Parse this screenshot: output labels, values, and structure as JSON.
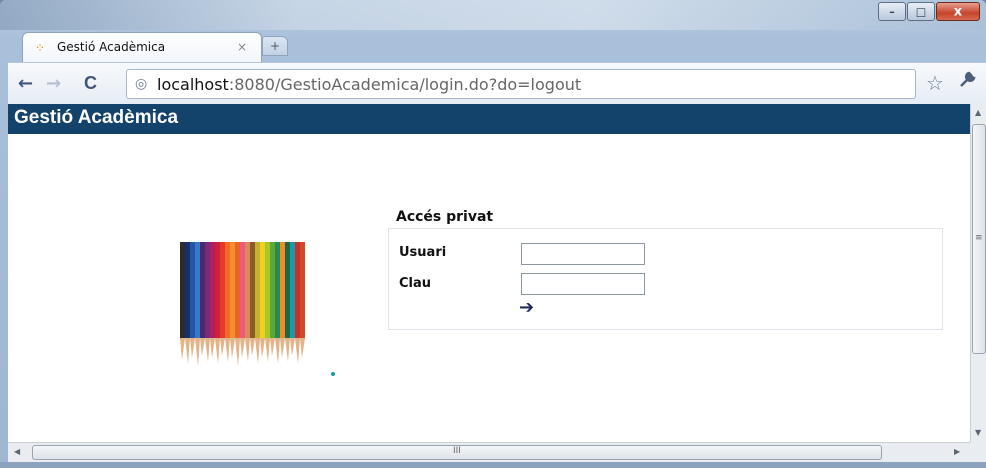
{
  "window": {
    "controls": {
      "minimize": "–",
      "maximize": "□",
      "close": "x"
    }
  },
  "tab": {
    "title": "Gestió Acadèmica",
    "close": "×",
    "new_tab": "+"
  },
  "toolbar": {
    "back": "←",
    "forward": "→",
    "reload": "C",
    "url_host": "localhost",
    "url_rest": ":8080/GestioAcademica/login.do?do=logout",
    "star": "☆",
    "wrench": "🔧"
  },
  "page": {
    "banner_title": "Gestió Acadèmica",
    "login": {
      "heading": "Accés privat",
      "user_label": "Usuari",
      "user_value": "",
      "password_label": "Clau",
      "password_value": "",
      "submit_icon": "arrow-right-icon",
      "submit_glyph": "➔"
    }
  },
  "colors": {
    "banner": "#13426b",
    "submit_arrow": "#1d2c55"
  },
  "scrollbars": {
    "vertical_grip": "≡",
    "horizontal_grip": "III"
  }
}
